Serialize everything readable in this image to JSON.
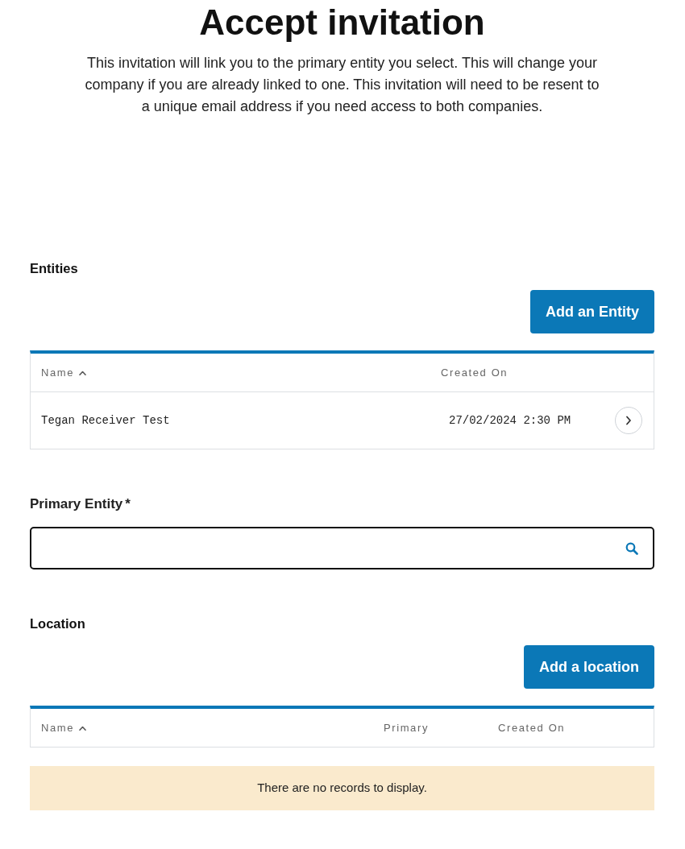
{
  "page": {
    "title": "Accept invitation",
    "description_lines": [
      "This invitation will link you to the primary entity you select. This will change your",
      "company if you are already linked to one. This invitation will need to be resent to",
      "a unique email address if you need access to both companies."
    ]
  },
  "entities": {
    "heading": "Entities",
    "add_button": "Add an Entity",
    "table": {
      "columns": [
        {
          "label": "Name",
          "sorted": true
        },
        {
          "label": "Created On",
          "sorted": false
        }
      ],
      "rows": [
        {
          "cells": [
            "Tegan Receiver Test",
            "27/02/2024 2:30 PM"
          ]
        }
      ]
    }
  },
  "primary_entity": {
    "label": "Primary Entity",
    "required_mark": "*"
  },
  "location": {
    "heading": "Location",
    "add_button": "Add a location",
    "table": {
      "columns": [
        {
          "label": "Name",
          "sorted": true
        },
        {
          "label": "Primary",
          "sorted": false
        },
        {
          "label": "Created On",
          "sorted": false
        }
      ]
    },
    "empty_message": "There are no records to display."
  }
}
